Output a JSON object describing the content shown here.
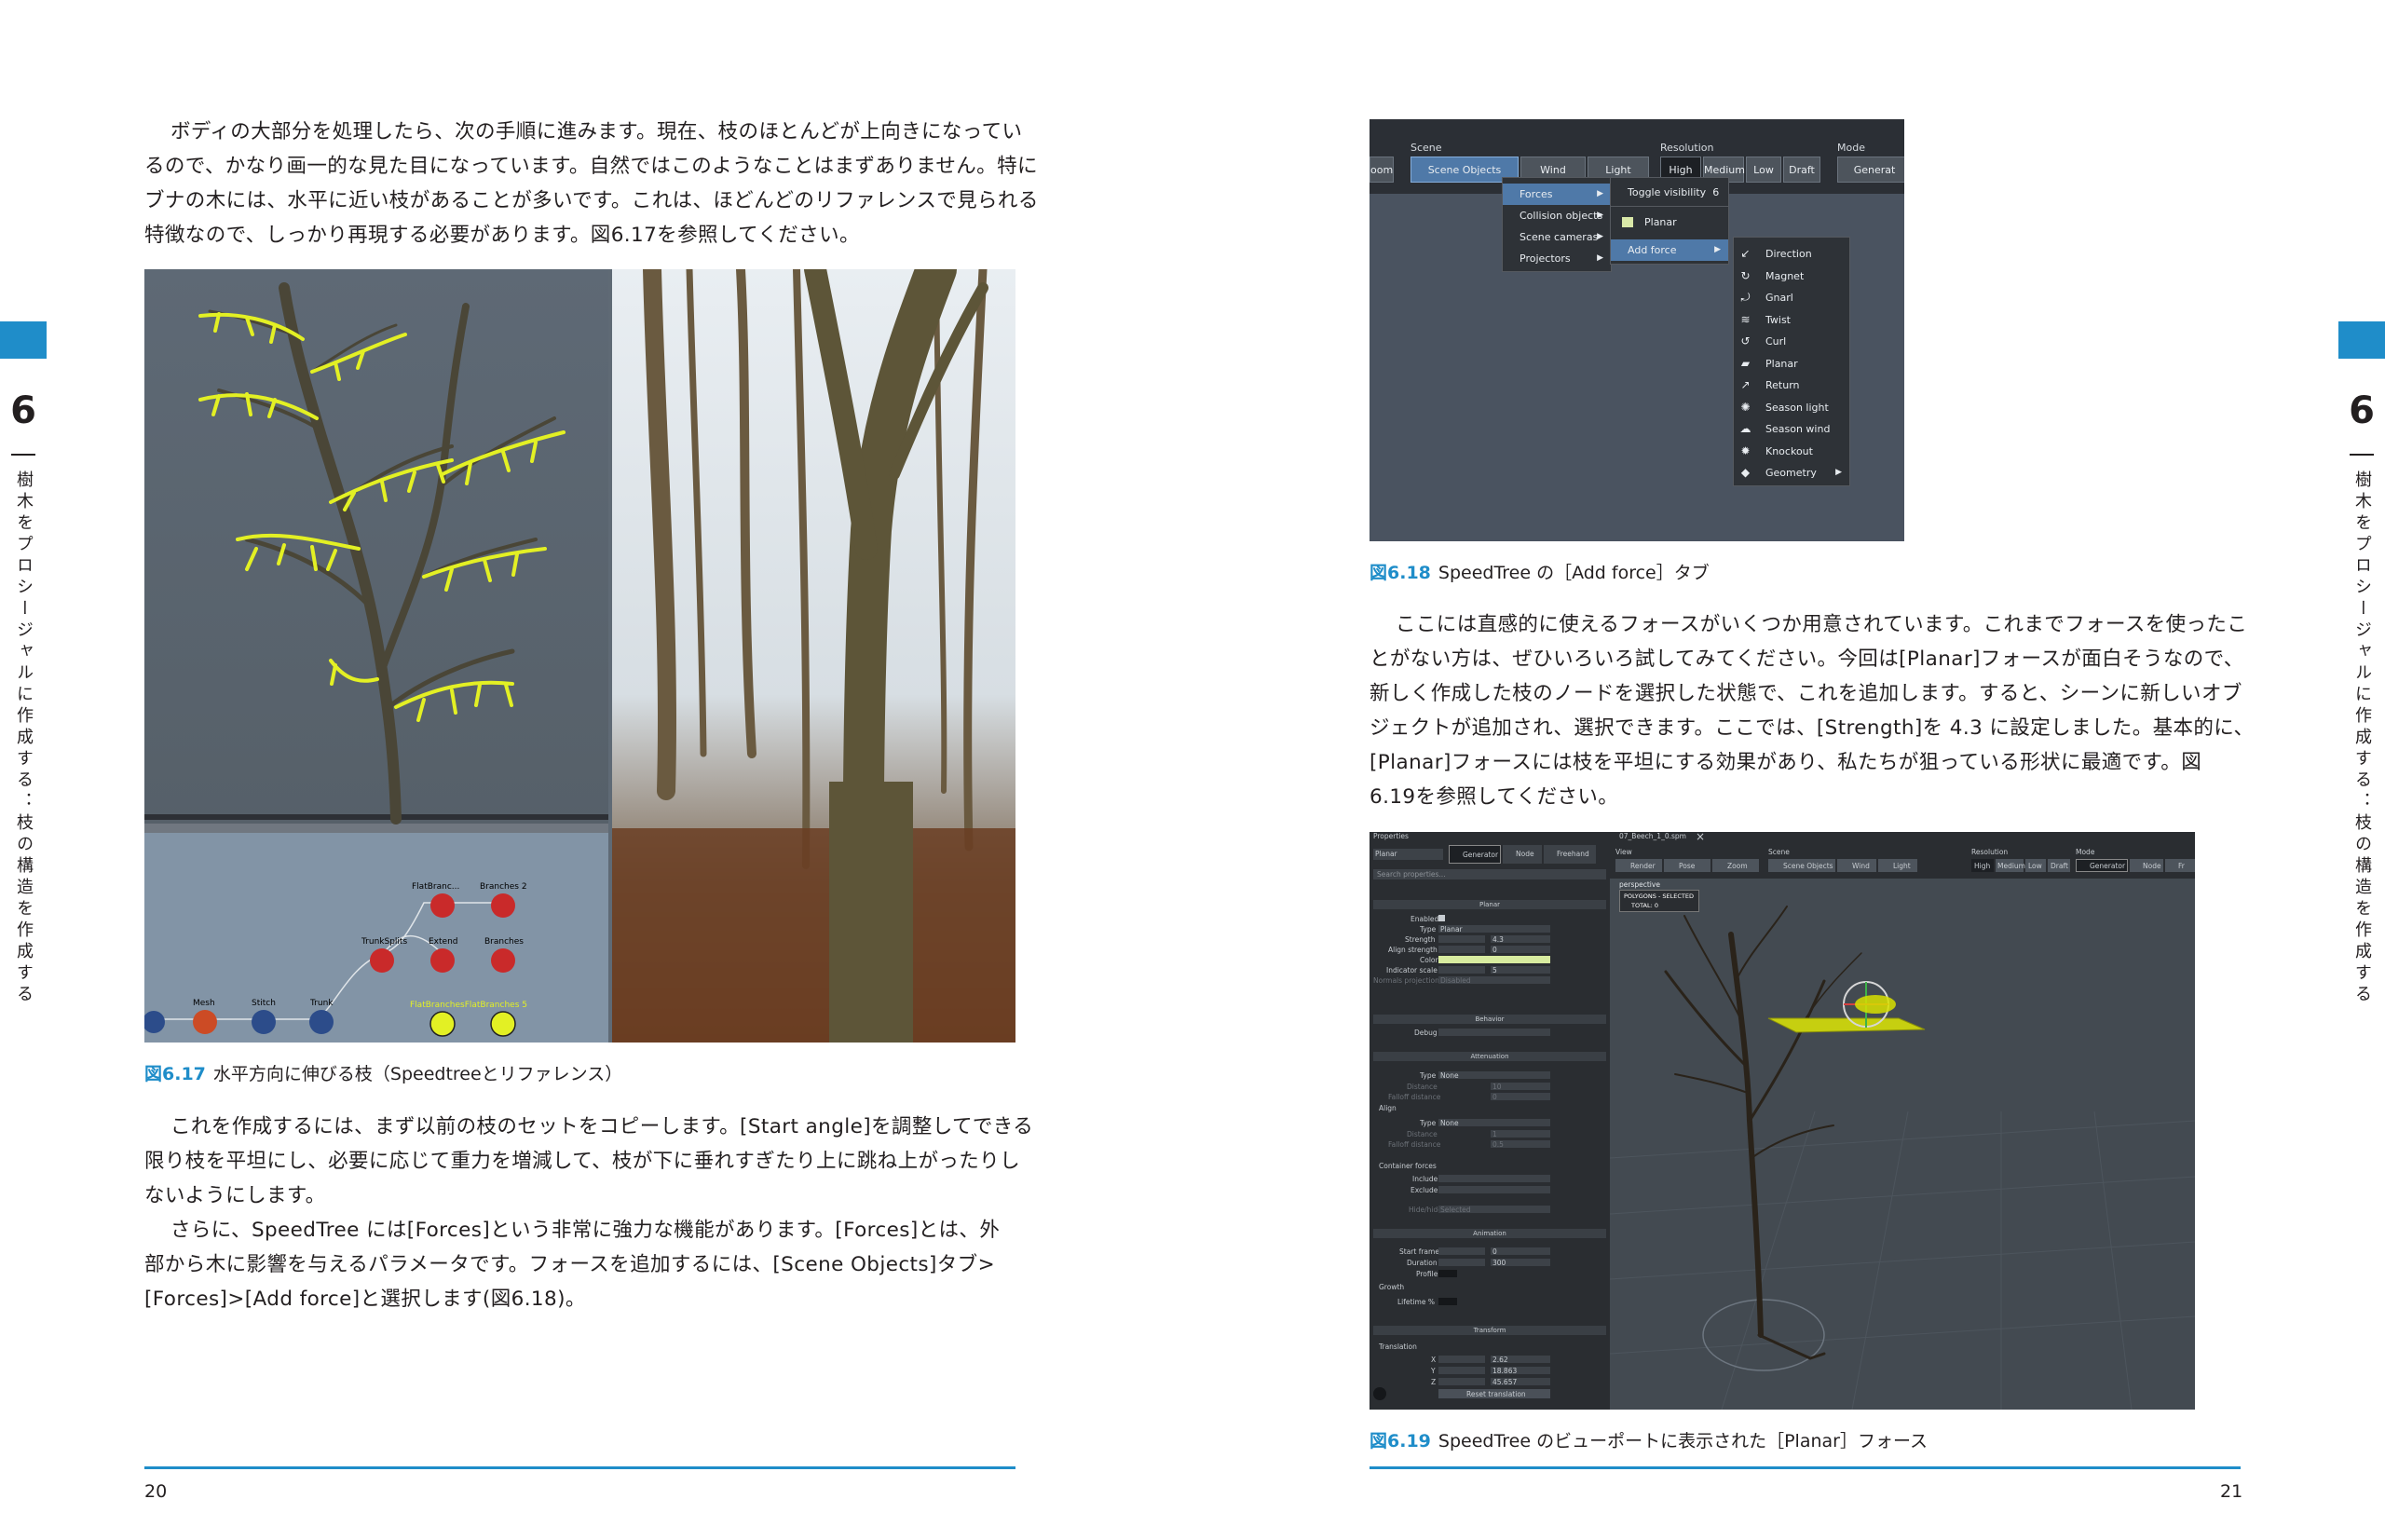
{
  "left_page": {
    "paragraph1": [
      "ボディの大部分を処理したら、次の手順に進みます。現在、枝のほとんどが上向きになってい",
      "るので、かなり画一的な見た目になっています。自然ではこのようなことはまずありません。特に",
      "ブナの木には、水平に近い枝があることが多いです。これは、ほどんどのリファレンスで見られる",
      "特徴なので、しっかり再現する必要があります。図6.17を参照してください。"
    ],
    "figure": {
      "number": "図6.17",
      "caption": "水平方向に伸びる枝（Speedtreeとリファレンス）",
      "nodes": [
        "FlatBranc...",
        "Branches 2",
        "TrunkSplits",
        "Extend",
        "Branches",
        "Mesh",
        "Stitch",
        "Trunk",
        "FlatBranchesFlatBranches 5"
      ]
    },
    "paragraph2": [
      "これを作成するには、まず以前の枝のセットをコピーします。[Start angle]を調整してできる",
      "限り枝を平坦にし、必要に応じて重力を増減して、枝が下に垂れすぎたり上に跳ね上がったりし",
      "ないようにします。"
    ],
    "paragraph3": [
      "さらに、SpeedTree には[Forces]という非常に強力な機能があります。[Forces]とは、外",
      "部から木に影響を与えるパラメータです。フォースを追加するには、[Scene Objects]タブ>",
      "[Forces]>[Add force]と選択します(図6.18)。"
    ],
    "page_number": "20"
  },
  "right_page": {
    "figure618": {
      "number": "図6.18",
      "caption": "SpeedTree の［Add force］タブ",
      "toolbar": {
        "scene_label": "Scene",
        "resolution_label": "Resolution",
        "mode_label": "Mode",
        "left_button": "oom",
        "scene_objects": "Scene Objects",
        "wind": "Wind",
        "light": "Light",
        "res_buttons": [
          "High",
          "Medium",
          "Low",
          "Draft"
        ],
        "mode_button": "Generat"
      },
      "menu1": [
        "Forces",
        "Collision objects",
        "Scene cameras",
        "Projectors"
      ],
      "menu2": {
        "toggle": "Toggle visibility",
        "toggle_count": "6",
        "planar": "Planar",
        "add_force": "Add force"
      },
      "menu3": [
        "Direction",
        "Magnet",
        "Gnarl",
        "Twist",
        "Curl",
        "Planar",
        "Return",
        "Season light",
        "Season wind",
        "Knockout",
        "Geometry"
      ],
      "menu3_icons": [
        "arrow-icon",
        "magnet-icon",
        "gnarl-icon",
        "twist-icon",
        "curl-icon",
        "planar-icon",
        "return-icon",
        "season-light-icon",
        "season-wind-icon",
        "knockout-icon",
        "geometry-icon"
      ]
    },
    "paragraph1": [
      "ここには直感的に使えるフォースがいくつか用意されています。これまでフォースを使ったこ",
      "とがない方は、ぜひいろいろ試してみてください。今回は[Planar]フォースが面白そうなので、",
      "新しく作成した枝のノードを選択した状態で、これを追加します。すると、シーンに新しいオブ",
      "ジェクトが追加され、選択できます。ここでは、[Strength]を 4.3 に設定しました。基本的に、",
      "[Planar]フォースには枝を平坦にする効果があり、私たちが狙っている形状に最適です。図",
      "6.19を参照してください。"
    ],
    "figure619": {
      "number": "図6.19",
      "caption": "SpeedTree のビューポートに表示された［Planar］フォース",
      "panel_title": "Properties",
      "file_tab": "07_Beech_1_0.spm",
      "tabs": [
        "Generator",
        "Node",
        "Freehand"
      ],
      "object_name": "Planar",
      "search_placeholder": "Search properties...",
      "sections": {
        "planar": "Planar",
        "behavior": "Behavior",
        "attenuation": "Attenuation",
        "animation": "Animation",
        "transform": "Transform"
      },
      "fields": {
        "enabled": "Enabled",
        "type": "Type",
        "type_value": "Planar",
        "strength": "Strength",
        "strength_value": "4.3",
        "align_strength": "Align strength",
        "align_strength_value": "0",
        "color": "Color",
        "indicator_scale": "Indicator scale",
        "indicator_scale_value": "5",
        "normals_projection": "Normals projection",
        "normals_projection_value": "Disabled",
        "debug": "Debug",
        "att_type": "Type",
        "att_type_value": "None",
        "distance": "Distance",
        "distance_value": "10",
        "falloff_distance": "Falloff distance",
        "falloff_distance_value": "0",
        "align": "Align",
        "align_type": "Type",
        "align_type_value": "None",
        "align_distance": "Distance",
        "align_distance_value": "1",
        "align_falloff": "Falloff distance",
        "align_falloff_value": "0.5",
        "container_forces": "Container forces",
        "include": "Include",
        "exclude": "Exclude",
        "hide_hide": "Hide/hide",
        "hide_value": "Selected",
        "start_frame": "Start frame",
        "start_frame_value": "0",
        "duration": "Duration",
        "duration_value": "300",
        "profile": "Profile",
        "growth": "Growth",
        "lifetime": "Lifetime %",
        "translation": "Translation",
        "x_value": "2.62",
        "y_value": "18.863",
        "z_value": "45.657",
        "reset_translation": "Reset translation"
      },
      "viewport": {
        "view_label": "View",
        "scene_label": "Scene",
        "resolution_label": "Resolution",
        "mode_label": "Mode",
        "view_buttons": [
          "Render",
          "Pose",
          "Zoom"
        ],
        "scene_buttons": [
          "Scene Objects",
          "Wind",
          "Light"
        ],
        "res_buttons": [
          "High",
          "Medium",
          "Low",
          "Draft"
        ],
        "mode_buttons": [
          "Generator",
          "Node",
          "Fr"
        ],
        "perspective": "perspective",
        "selection_title": "POLYGONS - SELECTED",
        "selection_total": "TOTAL: 0"
      }
    },
    "page_number": "21"
  },
  "side_tab": {
    "chapter": "6",
    "vertical_text": "樹木をプロシージャルに作成する：枝の構造を作成する"
  },
  "colors": {
    "accent": "#1f8dc9",
    "highlight_yellow": "#e3f024",
    "menu_selected": "#4f79a8"
  }
}
